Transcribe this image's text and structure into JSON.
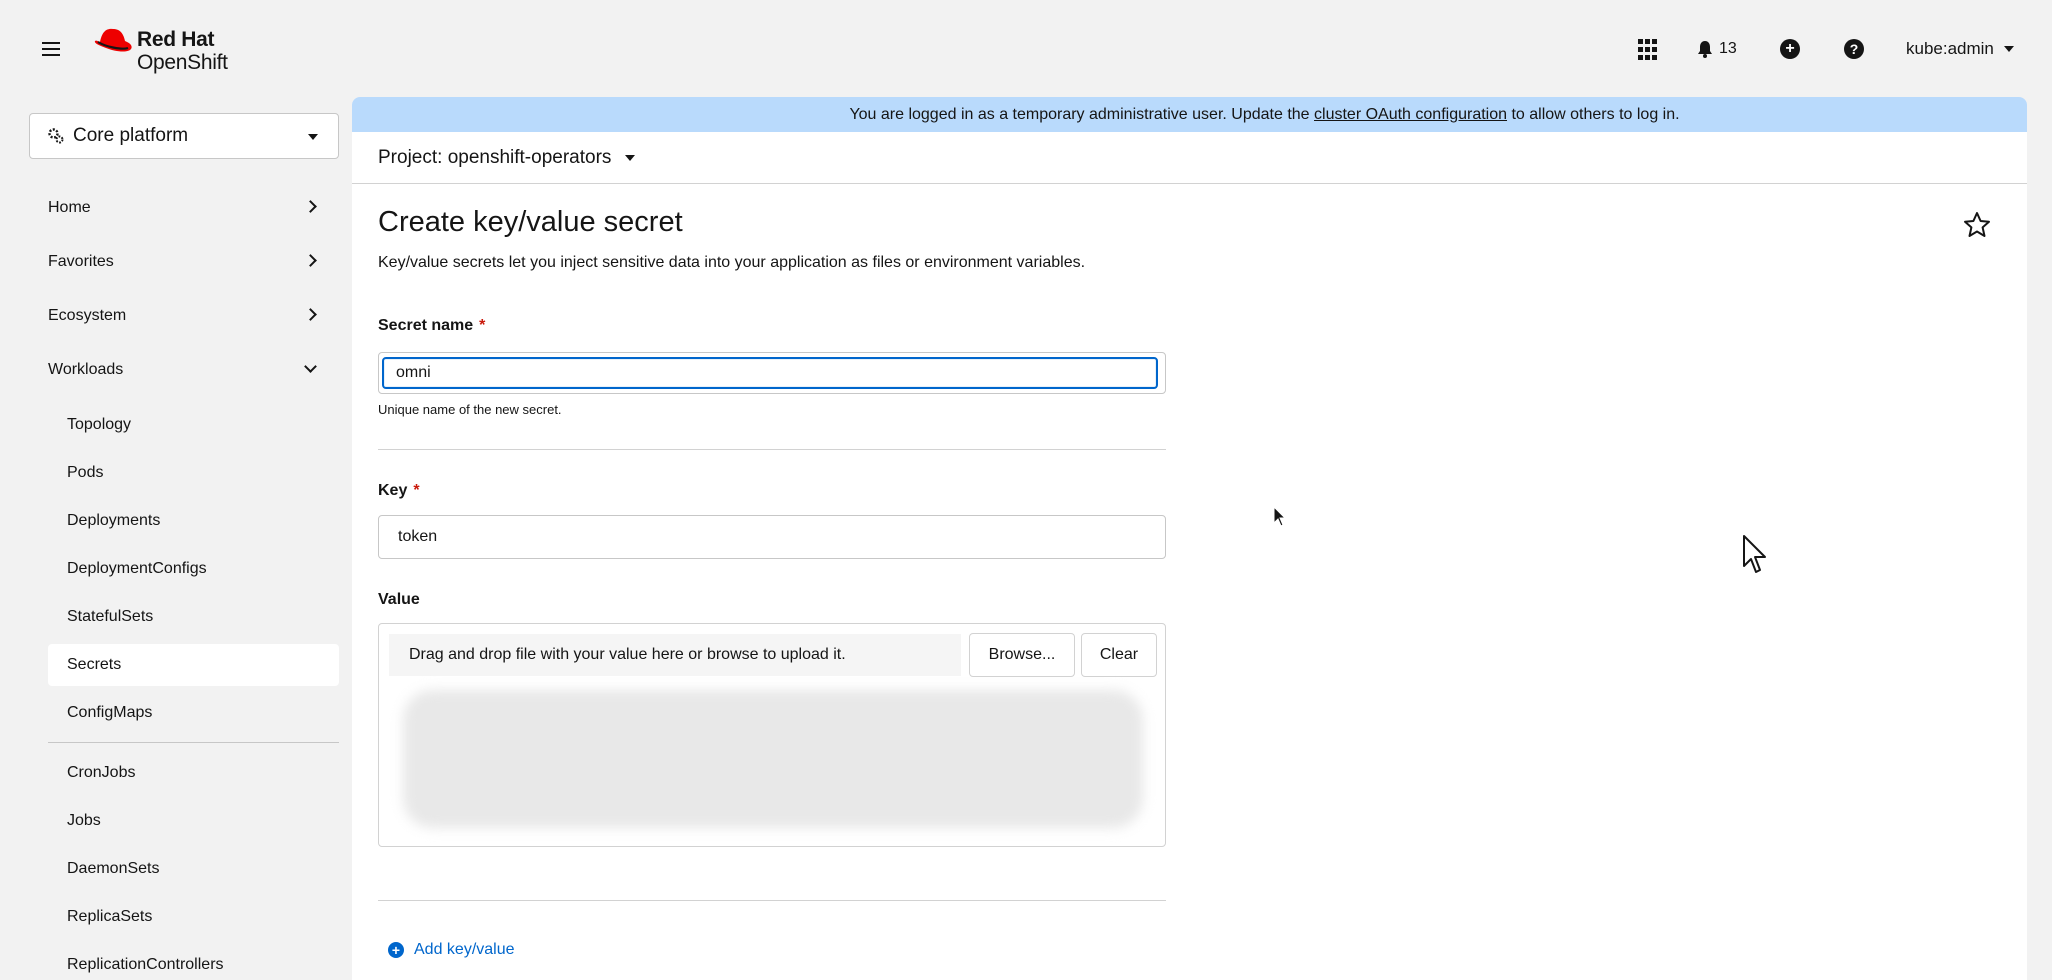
{
  "brand": {
    "line1": "Red Hat",
    "line2": "OpenShift",
    "color": "#ee0000"
  },
  "masthead": {
    "notifications_count": "13",
    "user": "kube:admin"
  },
  "sidebar": {
    "perspective": "Core platform",
    "sections": [
      {
        "label": "Home"
      },
      {
        "label": "Favorites"
      },
      {
        "label": "Ecosystem"
      },
      {
        "label": "Workloads"
      }
    ],
    "workloads_items": [
      {
        "label": "Topology"
      },
      {
        "label": "Pods"
      },
      {
        "label": "Deployments"
      },
      {
        "label": "DeploymentConfigs"
      },
      {
        "label": "StatefulSets"
      },
      {
        "label": "Secrets"
      },
      {
        "label": "ConfigMaps"
      },
      {
        "label": "CronJobs"
      },
      {
        "label": "Jobs"
      },
      {
        "label": "DaemonSets"
      },
      {
        "label": "ReplicaSets"
      },
      {
        "label": "ReplicationControllers"
      }
    ]
  },
  "banner": {
    "text_before": "You are logged in as a temporary administrative user. Update the ",
    "link": "cluster OAuth configuration",
    "text_after": " to allow others to log in."
  },
  "project": {
    "label": "Project: openshift-operators"
  },
  "page": {
    "title": "Create key/value secret",
    "description": "Key/value secrets let you inject sensitive data into your application as files or environment variables."
  },
  "form": {
    "secret_name_label": "Secret name",
    "required_mark": "*",
    "secret_name_value": "omni",
    "secret_name_helper": "Unique name of the new secret.",
    "key_label": "Key",
    "key_value": "token",
    "value_label": "Value",
    "drop_text": "Drag and drop file with your value here or browse to upload it.",
    "browse_label": "Browse...",
    "clear_label": "Clear",
    "add_kv_label": "Add key/value"
  }
}
